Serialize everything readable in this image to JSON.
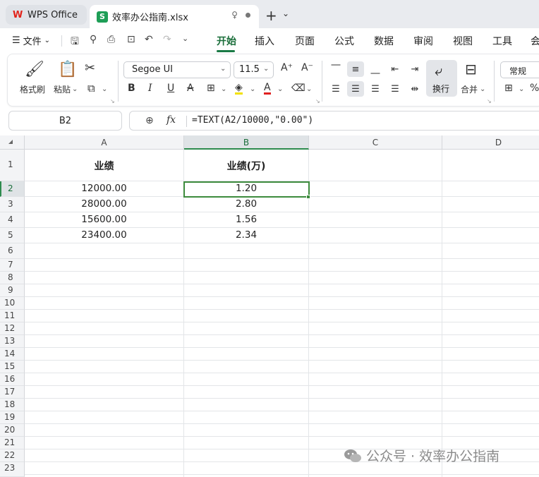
{
  "tabs": {
    "app_label": "WPS Office",
    "file_label": "效率办公指南.xlsx",
    "file_logo": "S"
  },
  "menu": {
    "file_label": "文件",
    "tabs": [
      "开始",
      "插入",
      "页面",
      "公式",
      "数据",
      "审阅",
      "视图",
      "工具",
      "会"
    ]
  },
  "ribbon": {
    "format_painter": "格式刷",
    "paste": "粘贴",
    "font_name": "Segoe UI",
    "font_size": "11.5",
    "wrap_text": "换行",
    "merge": "合并",
    "number_format": "常规"
  },
  "formula_bar": {
    "cell_ref": "B2",
    "fx_label": "fx",
    "formula": "=TEXT(A2/10000,\"0.00\")"
  },
  "sheet": {
    "columns": [
      "A",
      "B",
      "C",
      "D"
    ],
    "rows": [
      "1",
      "2",
      "3",
      "4",
      "5",
      "6",
      "7",
      "8",
      "9",
      "10",
      "11",
      "12",
      "13",
      "14",
      "15",
      "16",
      "17",
      "18",
      "19",
      "20",
      "21",
      "22",
      "23"
    ],
    "header_row": [
      "业绩",
      "业绩(万)"
    ],
    "data": [
      [
        "12000.00",
        "1.20"
      ],
      [
        "28000.00",
        "2.80"
      ],
      [
        "15600.00",
        "1.56"
      ],
      [
        "23400.00",
        "2.34"
      ]
    ],
    "selected_cell": "B2"
  },
  "watermark": "公众号 · 效率办公指南",
  "colors": {
    "accent": "#1a6e3a",
    "selection": "#3d8b3d",
    "wps_red": "#e2231a",
    "sheet_green": "#1e9e56"
  }
}
